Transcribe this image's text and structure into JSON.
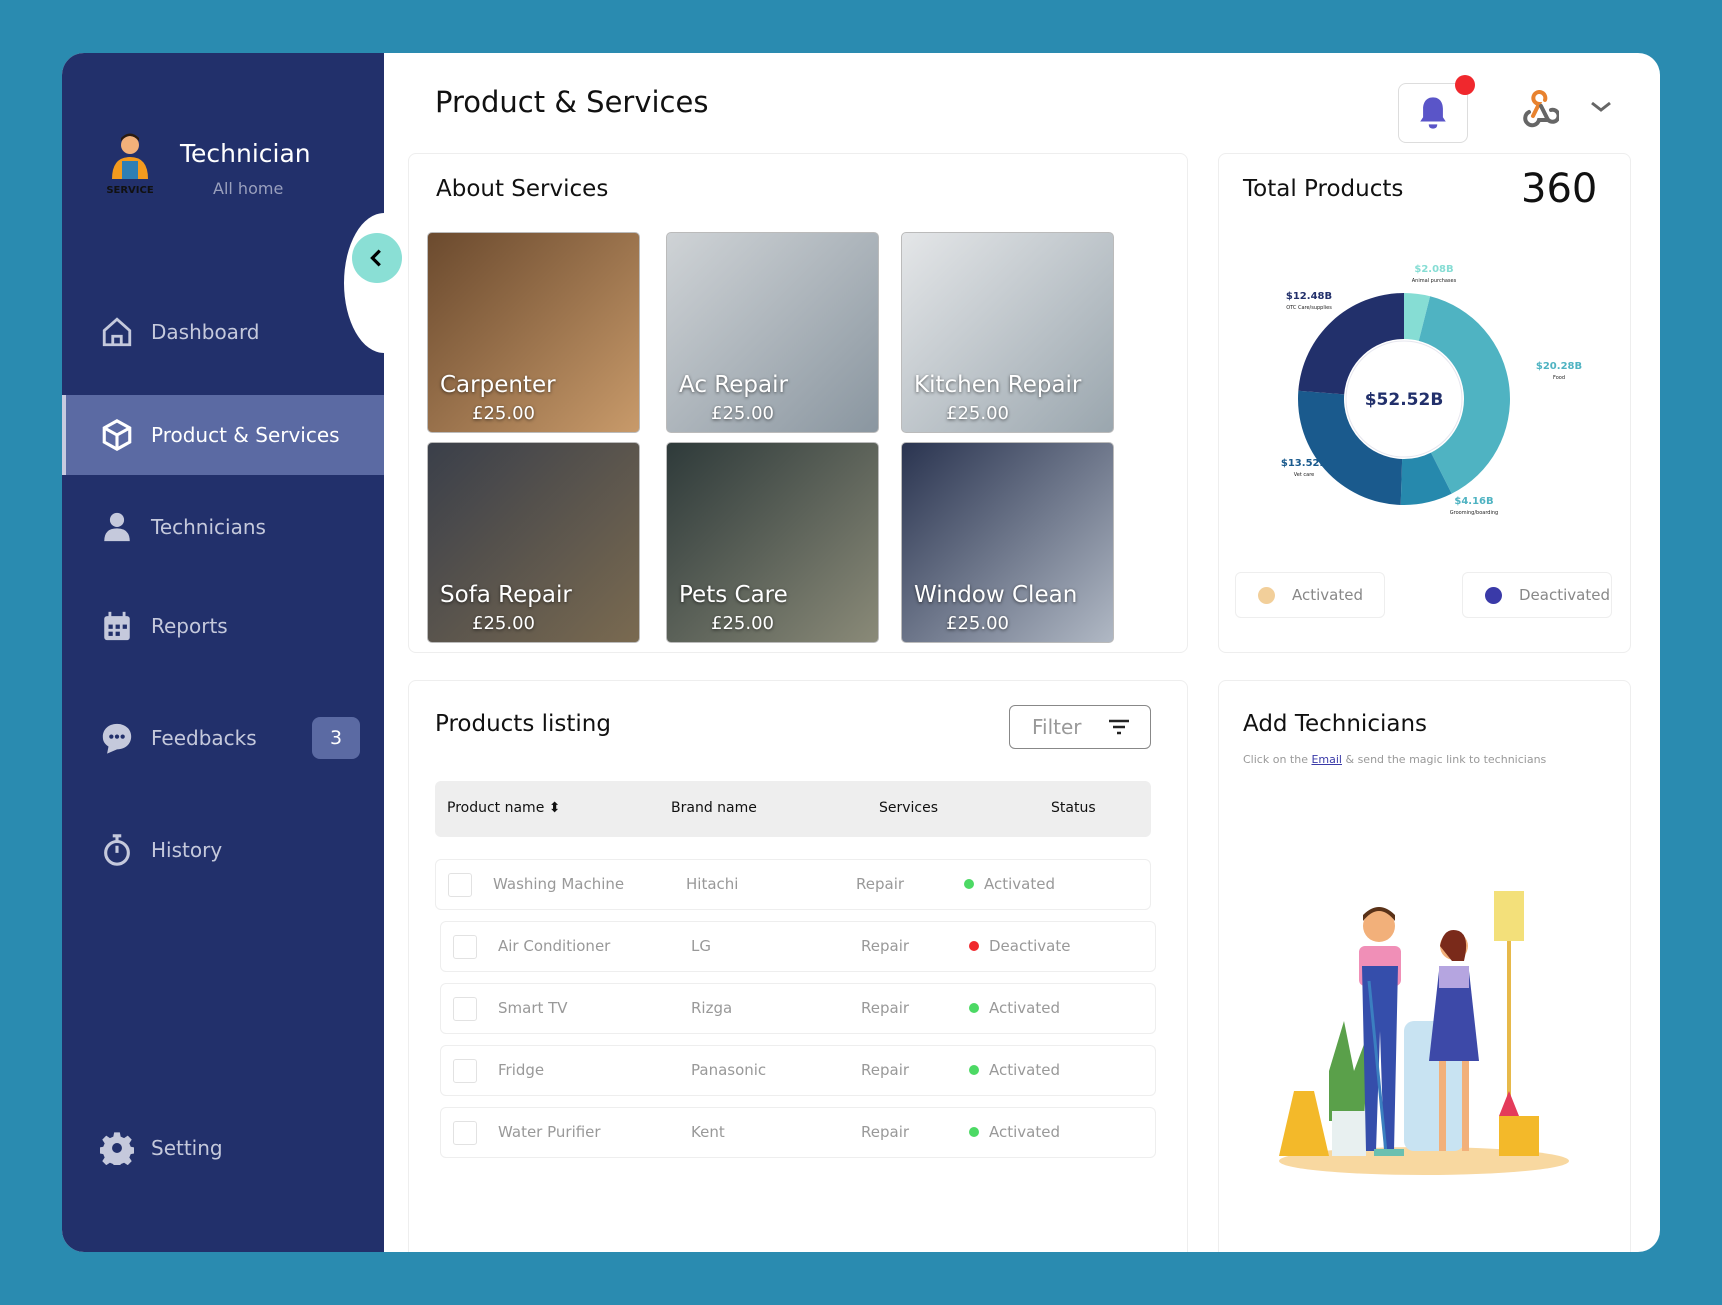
{
  "sidebar": {
    "brand": "Technician",
    "subtitle": "All home",
    "logo_text": "SERVICE",
    "items": [
      {
        "label": "Dashboard",
        "icon": "home-icon"
      },
      {
        "label": "Product & Services",
        "icon": "box-icon",
        "active": true
      },
      {
        "label": "Technicians",
        "icon": "user-icon"
      },
      {
        "label": "Reports",
        "icon": "calendar-icon"
      },
      {
        "label": "Feedbacks",
        "icon": "chat-icon",
        "badge": "3"
      },
      {
        "label": "History",
        "icon": "stopwatch-icon"
      },
      {
        "label": "Setting",
        "icon": "gear-icon"
      }
    ]
  },
  "header": {
    "title": "Product & Services"
  },
  "about": {
    "title": "About Services",
    "services": [
      {
        "name": "Carpenter",
        "price": "£25.00"
      },
      {
        "name": "Ac Repair",
        "price": "£25.00"
      },
      {
        "name": "Kitchen Repair",
        "price": "£25.00"
      },
      {
        "name": "Sofa Repair",
        "price": "£25.00"
      },
      {
        "name": "Pets Care",
        "price": "£25.00"
      },
      {
        "name": "Window Clean",
        "price": "£25.00"
      }
    ]
  },
  "total": {
    "title": "Total Products",
    "count": "360",
    "legend": [
      {
        "label": "Activated",
        "color": "#f2cf9a"
      },
      {
        "label": "Deactivated",
        "color": "#3a3aa8"
      }
    ]
  },
  "chart_data": {
    "type": "pie",
    "title": "$52.52B",
    "total": 52.52,
    "slices": [
      {
        "label": "Animal purchases",
        "value": 2.08,
        "text": "$2.08B",
        "color": "#86ddd4"
      },
      {
        "label": "Food",
        "value": 20.28,
        "text": "$20.28B",
        "color": "#4fb3c2"
      },
      {
        "label": "Grooming/boarding",
        "value": 4.16,
        "text": "$4.16B",
        "color": "#2689ad"
      },
      {
        "label": "Vet care",
        "value": 13.52,
        "text": "$13.52B",
        "color": "#1a5a8d"
      },
      {
        "label": "OTC Care/supplies",
        "value": 12.48,
        "text": "$12.48B",
        "color": "#22306b"
      }
    ]
  },
  "listing": {
    "title": "Products listing",
    "filter": "Filter",
    "columns": [
      "Product name",
      "Brand name",
      "Services",
      "Status"
    ],
    "rows": [
      [
        "Washing Machine",
        "Hitachi",
        "Repair",
        "Activated"
      ],
      [
        "Air Conditioner",
        "LG",
        "Repair",
        "Deactivate"
      ],
      [
        "Smart TV",
        "Rizga",
        "Repair",
        "Activated"
      ],
      [
        "Fridge",
        "Panasonic",
        "Repair",
        "Activated"
      ],
      [
        "Water Purifier",
        "Kent",
        "Repair",
        "Activated"
      ]
    ]
  },
  "add": {
    "title": "Add Technicians",
    "pre": "Click on the ",
    "link": "Email",
    "post": " & send the magic link to technicians"
  }
}
